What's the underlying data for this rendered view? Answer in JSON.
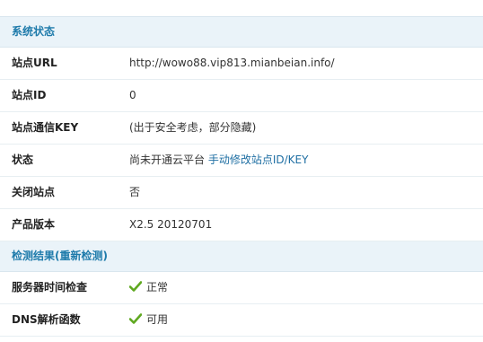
{
  "system_status": {
    "title": "系统状态",
    "rows": [
      {
        "label": "站点URL",
        "value": "http://wowo88.vip813.mianbeian.info/"
      },
      {
        "label": "站点ID",
        "value": "0"
      },
      {
        "label": "站点通信KEY",
        "value": "(出于安全考虑，部分隐藏)"
      },
      {
        "label": "状态",
        "value": "尚未开通云平台",
        "link": "手动修改站点ID/KEY"
      },
      {
        "label": "关闭站点",
        "value": "否"
      },
      {
        "label": "产品版本",
        "value": "X2.5 20120701"
      }
    ]
  },
  "check_results": {
    "title": "检测结果(重新检测)",
    "rows": [
      {
        "label": "服务器时间检查",
        "value": "正常",
        "icon": "check-icon"
      },
      {
        "label": "DNS解析函数",
        "value": "可用",
        "icon": "check-icon"
      }
    ]
  },
  "colors": {
    "header_bg": "#eaf3f9",
    "header_text": "#1f7bab",
    "link": "#1f6fa3",
    "check": "#5fa820"
  }
}
